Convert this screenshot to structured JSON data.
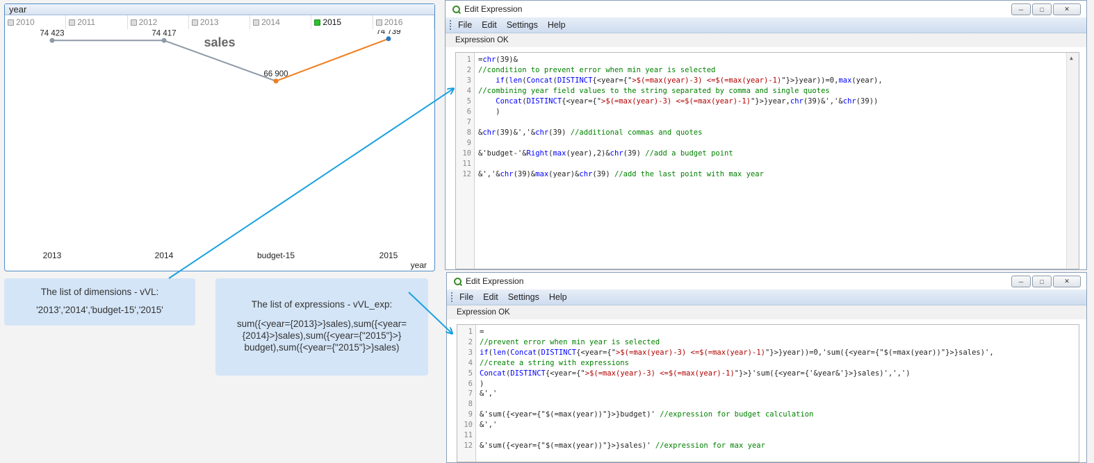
{
  "yearbox": {
    "caption": "year",
    "values": [
      {
        "label": "2010",
        "selected": false
      },
      {
        "label": "2011",
        "selected": false
      },
      {
        "label": "2012",
        "selected": false
      },
      {
        "label": "2013",
        "selected": false
      },
      {
        "label": "2014",
        "selected": false
      },
      {
        "label": "2015",
        "selected": true
      },
      {
        "label": "2016",
        "selected": false
      }
    ]
  },
  "chart_data": {
    "type": "line",
    "title": "sales",
    "xlabel": "year",
    "ylabel": "",
    "categories": [
      "2013",
      "2014",
      "budget-15",
      "2015"
    ],
    "values": [
      74423,
      74417,
      66900,
      74739
    ],
    "value_labels": [
      "74 423",
      "74 417",
      "66 900",
      "74 739"
    ],
    "ylim": [
      0,
      80000
    ],
    "segment_colors": [
      "#8e99a8",
      "#8e99a8",
      "#f07f21"
    ],
    "point_colors": [
      "#8e99a8",
      "#8e99a8",
      "#f07f21",
      "#2b78c6"
    ],
    "grid": false
  },
  "callouts": {
    "dimensions": {
      "line1": "The list of dimensions - vVL:",
      "line2": "'2013','2014','budget-15','2015'"
    },
    "expressions": {
      "line1": "The list of expressions - vVL_exp:",
      "line2": "sum({<year={2013}>}sales),sum({<year=",
      "line3": "{2014}>}sales),sum({<year={\"2015\"}>}",
      "line4": "budget),sum({<year={\"2015\"}>}sales)"
    }
  },
  "window1": {
    "title": "Edit Expression",
    "menu": [
      "File",
      "Edit",
      "Settings",
      "Help"
    ],
    "status": "Expression OK",
    "lines": [
      {
        "n": "1",
        "segs": [
          {
            "c": "tx",
            "t": "="
          },
          {
            "c": "fn",
            "t": "chr"
          },
          {
            "c": "tx",
            "t": "(39)&"
          }
        ]
      },
      {
        "n": "2",
        "segs": [
          {
            "c": "cm",
            "t": "//condition to prevent error when min year is selected"
          }
        ]
      },
      {
        "n": "3",
        "segs": [
          {
            "c": "tx",
            "t": "    "
          },
          {
            "c": "fn",
            "t": "if"
          },
          {
            "c": "tx",
            "t": "("
          },
          {
            "c": "fn",
            "t": "len"
          },
          {
            "c": "tx",
            "t": "("
          },
          {
            "c": "fn",
            "t": "Concat"
          },
          {
            "c": "tx",
            "t": "("
          },
          {
            "c": "fn",
            "t": "DISTINCT"
          },
          {
            "c": "tx",
            "t": "{<year={\""
          },
          {
            "c": "st",
            "t": ">$(=max(year)-3) <=$(=max(year)-1)"
          },
          {
            "c": "tx",
            "t": "\"}>}year))=0,"
          },
          {
            "c": "fn",
            "t": "max"
          },
          {
            "c": "tx",
            "t": "(year),"
          }
        ]
      },
      {
        "n": "4",
        "segs": [
          {
            "c": "cm",
            "t": "//combining year field values to the string separated by comma and single quotes"
          }
        ]
      },
      {
        "n": "5",
        "segs": [
          {
            "c": "tx",
            "t": "    "
          },
          {
            "c": "fn",
            "t": "Concat"
          },
          {
            "c": "tx",
            "t": "("
          },
          {
            "c": "fn",
            "t": "DISTINCT"
          },
          {
            "c": "tx",
            "t": "{<year={\""
          },
          {
            "c": "st",
            "t": ">$(=max(year)-3) <=$(=max(year)-1)"
          },
          {
            "c": "tx",
            "t": "\"}>}year,"
          },
          {
            "c": "fn",
            "t": "chr"
          },
          {
            "c": "tx",
            "t": "(39)&','&"
          },
          {
            "c": "fn",
            "t": "chr"
          },
          {
            "c": "tx",
            "t": "(39))"
          }
        ]
      },
      {
        "n": "6",
        "segs": [
          {
            "c": "tx",
            "t": "    )"
          }
        ]
      },
      {
        "n": "7",
        "segs": []
      },
      {
        "n": "8",
        "segs": [
          {
            "c": "tx",
            "t": "&"
          },
          {
            "c": "fn",
            "t": "chr"
          },
          {
            "c": "tx",
            "t": "(39)&','&"
          },
          {
            "c": "fn",
            "t": "chr"
          },
          {
            "c": "tx",
            "t": "(39) "
          },
          {
            "c": "cm",
            "t": "//additional commas and quotes"
          }
        ]
      },
      {
        "n": "9",
        "segs": []
      },
      {
        "n": "10",
        "segs": [
          {
            "c": "tx",
            "t": "&'budget-'&"
          },
          {
            "c": "fn",
            "t": "Right"
          },
          {
            "c": "tx",
            "t": "("
          },
          {
            "c": "fn",
            "t": "max"
          },
          {
            "c": "tx",
            "t": "(year),2)&"
          },
          {
            "c": "fn",
            "t": "chr"
          },
          {
            "c": "tx",
            "t": "(39) "
          },
          {
            "c": "cm",
            "t": "//add a budget point"
          }
        ]
      },
      {
        "n": "11",
        "segs": []
      },
      {
        "n": "12",
        "segs": [
          {
            "c": "tx",
            "t": "&','&"
          },
          {
            "c": "fn",
            "t": "chr"
          },
          {
            "c": "tx",
            "t": "(39)&"
          },
          {
            "c": "fn",
            "t": "max"
          },
          {
            "c": "tx",
            "t": "(year)&"
          },
          {
            "c": "fn",
            "t": "chr"
          },
          {
            "c": "tx",
            "t": "(39) "
          },
          {
            "c": "cm",
            "t": "//add the last point with max year"
          }
        ]
      }
    ]
  },
  "window2": {
    "title": "Edit Expression",
    "menu": [
      "File",
      "Edit",
      "Settings",
      "Help"
    ],
    "status": "Expression OK",
    "lines": [
      {
        "n": "1",
        "segs": [
          {
            "c": "tx",
            "t": "="
          }
        ]
      },
      {
        "n": "2",
        "segs": [
          {
            "c": "cm",
            "t": "//prevent error when min year is selected"
          }
        ]
      },
      {
        "n": "3",
        "segs": [
          {
            "c": "fn",
            "t": "if"
          },
          {
            "c": "tx",
            "t": "("
          },
          {
            "c": "fn",
            "t": "len"
          },
          {
            "c": "tx",
            "t": "("
          },
          {
            "c": "fn",
            "t": "Concat"
          },
          {
            "c": "tx",
            "t": "("
          },
          {
            "c": "fn",
            "t": "DISTINCT"
          },
          {
            "c": "tx",
            "t": "{<year={\""
          },
          {
            "c": "st",
            "t": ">$(=max(year)-3) <=$(=max(year)-1)"
          },
          {
            "c": "tx",
            "t": "\"}>}year))=0,'sum({<year={\"$(=max(year))\"}>}sales)',"
          }
        ]
      },
      {
        "n": "4",
        "segs": [
          {
            "c": "cm",
            "t": "//create a string with expressions"
          }
        ]
      },
      {
        "n": "5",
        "segs": [
          {
            "c": "fn",
            "t": "Concat"
          },
          {
            "c": "tx",
            "t": "("
          },
          {
            "c": "fn",
            "t": "DISTINCT"
          },
          {
            "c": "tx",
            "t": "{<year={\""
          },
          {
            "c": "st",
            "t": ">$(=max(year)-3) <=$(=max(year)-1)"
          },
          {
            "c": "tx",
            "t": "\"}>}'sum({<year={'&year&'}>}sales)',',')"
          }
        ]
      },
      {
        "n": "6",
        "segs": [
          {
            "c": "tx",
            "t": ")"
          }
        ]
      },
      {
        "n": "7",
        "segs": [
          {
            "c": "tx",
            "t": "&','"
          }
        ]
      },
      {
        "n": "8",
        "segs": []
      },
      {
        "n": "9",
        "segs": [
          {
            "c": "tx",
            "t": "&'sum({<year={\"$(=max(year))\"}>}budget)' "
          },
          {
            "c": "cm",
            "t": "//expression for budget calculation"
          }
        ]
      },
      {
        "n": "10",
        "segs": [
          {
            "c": "tx",
            "t": "&','"
          }
        ]
      },
      {
        "n": "11",
        "segs": []
      },
      {
        "n": "12",
        "segs": [
          {
            "c": "tx",
            "t": "&'sum({<year={\"$(=max(year))\"}>}sales)' "
          },
          {
            "c": "cm",
            "t": "//expression for max year"
          }
        ]
      }
    ]
  },
  "colors": {
    "accent_blue": "#1aa0e0",
    "window_border": "#8aa0b8",
    "callout_bg": "#d4e5f7"
  }
}
